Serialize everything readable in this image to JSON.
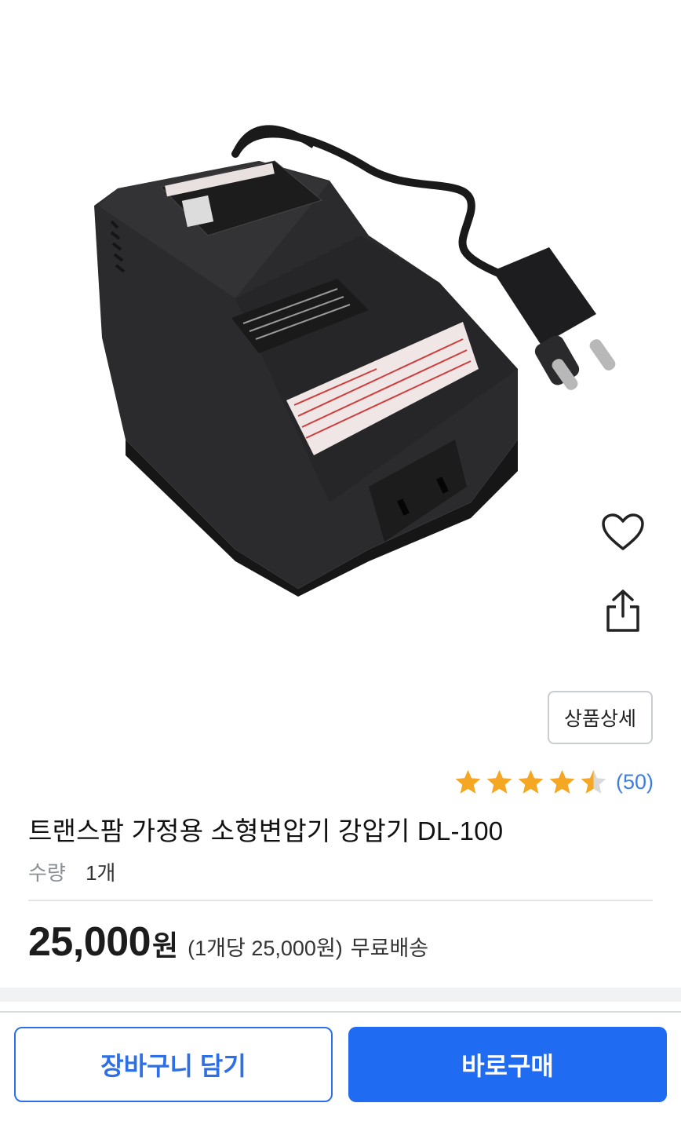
{
  "product": {
    "image_alt": "transformer-product-photo",
    "title": "트랜스팜 가정용 소형변압기 강압기 DL-100",
    "detail_button": "상품상세",
    "rating": {
      "value": 4.5,
      "max": 5,
      "review_count": "(50)"
    },
    "quantity_label": "수량",
    "quantity_value": "1개",
    "price": "25,000",
    "price_unit": "원",
    "unit_price": "(1개당 25,000원)",
    "shipping": "무료배송"
  },
  "actions": {
    "wishlist_icon": "heart-outline-icon",
    "share_icon": "share-icon",
    "cart_button": "장바구니 담기",
    "buy_button": "바로구매"
  },
  "colors": {
    "star": "#f5a623",
    "star_empty": "#d9d9d9",
    "link_blue": "#3f7de0",
    "primary": "#1f6bf2"
  }
}
